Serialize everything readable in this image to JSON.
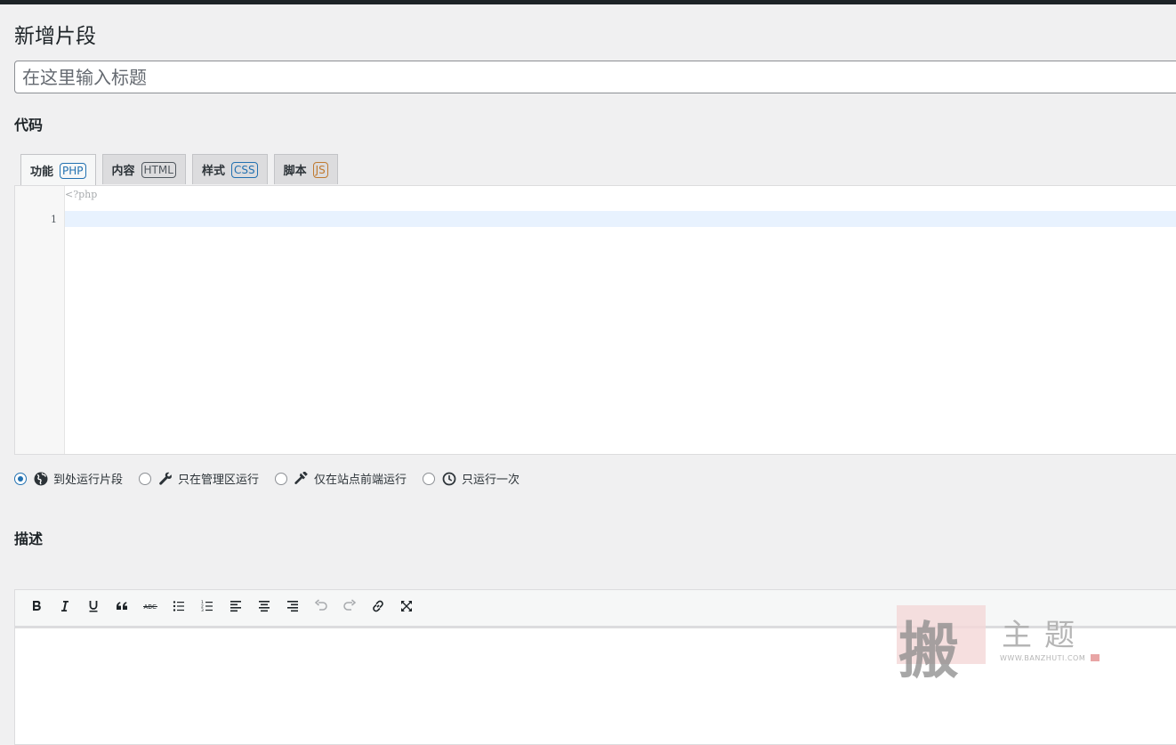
{
  "header": {
    "title": "新增片段"
  },
  "title_field": {
    "placeholder": "在这里输入标题",
    "value": ""
  },
  "code_section": {
    "label": "代码",
    "tabs": [
      {
        "label": "功能",
        "badge": "PHP",
        "active": true
      },
      {
        "label": "内容",
        "badge": "HTML",
        "active": false
      },
      {
        "label": "样式",
        "badge": "CSS",
        "active": false
      },
      {
        "label": "脚本",
        "badge": "JS",
        "active": false
      }
    ],
    "editor": {
      "prefix": "<?php",
      "line_numbers": [
        "1"
      ]
    }
  },
  "scope_options": [
    {
      "label": "到处运行片段",
      "icon": "globe-icon",
      "checked": true
    },
    {
      "label": "只在管理区运行",
      "icon": "wrench-icon",
      "checked": false
    },
    {
      "label": "仅在站点前端运行",
      "icon": "hammer-icon",
      "checked": false
    },
    {
      "label": "只运行一次",
      "icon": "clock-icon",
      "checked": false
    }
  ],
  "description_section": {
    "label": "描述",
    "toolbar": [
      "bold-icon",
      "italic-icon",
      "underline-icon",
      "blockquote-icon",
      "strikethrough-icon",
      "bullet-list-icon",
      "numbered-list-icon",
      "align-left-icon",
      "align-center-icon",
      "align-right-icon",
      "undo-icon",
      "redo-icon",
      "link-icon",
      "fullscreen-icon"
    ]
  },
  "watermark": {
    "seal_char": "搬",
    "text": "主题",
    "url": "WWW.BANZHUTI.COM"
  },
  "colors": {
    "accent": "#2271b1",
    "background": "#f0f0f1",
    "topbar": "#1d2327"
  }
}
